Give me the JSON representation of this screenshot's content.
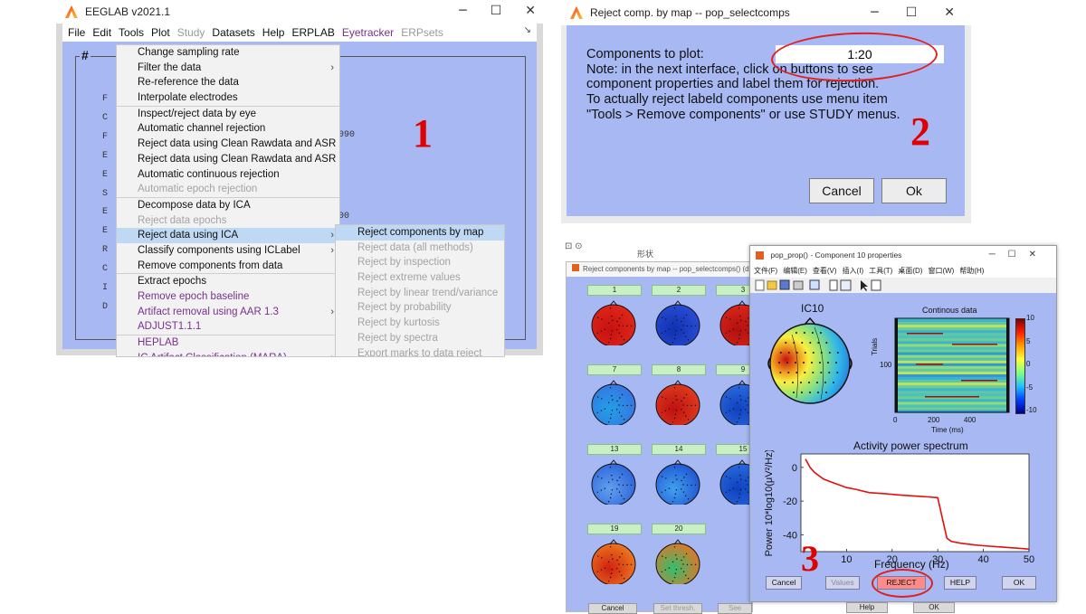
{
  "eeglab": {
    "title": "EEGLAB v2021.1",
    "menubar": [
      {
        "label": "File",
        "state": "normal"
      },
      {
        "label": "Edit",
        "state": "normal"
      },
      {
        "label": "Tools",
        "state": "normal"
      },
      {
        "label": "Plot",
        "state": "normal"
      },
      {
        "label": "Study",
        "state": "disabled"
      },
      {
        "label": "Datasets",
        "state": "normal"
      },
      {
        "label": "Help",
        "state": "normal"
      },
      {
        "label": "ERPLAB",
        "state": "normal"
      },
      {
        "label": "Eyetracker",
        "state": "purple"
      },
      {
        "label": "ERPsets",
        "state": "disabled"
      }
    ],
    "pane_header": "#",
    "side_letters": [
      "F",
      "C",
      "F",
      "E",
      "E",
      "S",
      "E",
      "E",
      "R",
      "C",
      "I",
      "D"
    ],
    "side_values": [
      "090",
      "00"
    ],
    "tools_menu": [
      {
        "label": "Change sampling rate",
        "state": "normal",
        "sub": false,
        "sep": false
      },
      {
        "label": "Filter the data",
        "state": "normal",
        "sub": true,
        "sep": false
      },
      {
        "label": "Re-reference the data",
        "state": "normal",
        "sub": false,
        "sep": false
      },
      {
        "label": "Interpolate electrodes",
        "state": "normal",
        "sub": false,
        "sep": false
      },
      {
        "label": "Inspect/reject data by eye",
        "state": "normal",
        "sub": false,
        "sep": true
      },
      {
        "label": "Automatic channel rejection",
        "state": "normal",
        "sub": false,
        "sep": false
      },
      {
        "label": "Reject data using Clean Rawdata and ASR",
        "state": "normal",
        "sub": false,
        "sep": false
      },
      {
        "label": "Reject data using Clean Rawdata and ASR",
        "state": "normal",
        "sub": false,
        "sep": false
      },
      {
        "label": "Automatic continuous rejection",
        "state": "normal",
        "sub": false,
        "sep": false
      },
      {
        "label": "Automatic epoch rejection",
        "state": "disabled",
        "sub": false,
        "sep": false
      },
      {
        "label": "Decompose data by ICA",
        "state": "normal",
        "sub": false,
        "sep": true
      },
      {
        "label": "Reject data epochs",
        "state": "disabled",
        "sub": false,
        "sep": false
      },
      {
        "label": "Reject data using ICA",
        "state": "selected",
        "sub": true,
        "sep": false
      },
      {
        "label": "Classify components using ICLabel",
        "state": "normal",
        "sub": true,
        "sep": false
      },
      {
        "label": "Remove components from data",
        "state": "normal",
        "sub": false,
        "sep": false
      },
      {
        "label": "Extract epochs",
        "state": "normal",
        "sub": false,
        "sep": true
      },
      {
        "label": "Remove epoch baseline",
        "state": "purple",
        "sub": false,
        "sep": false
      },
      {
        "label": "Artifact removal using AAR 1.3",
        "state": "purple",
        "sub": true,
        "sep": false
      },
      {
        "label": "ADJUST1.1.1",
        "state": "purple",
        "sub": false,
        "sep": false
      },
      {
        "label": "HEPLAB",
        "state": "purple",
        "sub": false,
        "sep": true
      },
      {
        "label": "IC Artifact Classification (MARA)",
        "state": "purple",
        "sub": true,
        "sep": false
      }
    ],
    "ica_submenu": [
      {
        "label": "Reject components by map",
        "state": "selected"
      },
      {
        "label": "Reject data (all methods)",
        "state": "disabled"
      },
      {
        "label": "Reject by inspection",
        "state": "disabled"
      },
      {
        "label": "Reject extreme values",
        "state": "disabled"
      },
      {
        "label": "Reject by linear trend/variance",
        "state": "disabled"
      },
      {
        "label": "Reject by probability",
        "state": "disabled"
      },
      {
        "label": "Reject by kurtosis",
        "state": "disabled"
      },
      {
        "label": "Reject by spectra",
        "state": "disabled"
      },
      {
        "label": "Export marks to data reject",
        "state": "disabled"
      }
    ]
  },
  "steps": {
    "one": "1",
    "two": "2",
    "three": "3"
  },
  "dialog2": {
    "title": "Reject comp. by map -- pop_selectcomps",
    "label": "Components to plot:",
    "value": "1:20",
    "note_lines": [
      "Note: in the next interface, click on buttons to see",
      "component properties and label them for rejection.",
      "To actually reject labeld components use menu item",
      "\"Tools > Remove components\" or use STUDY menus."
    ],
    "cancel": "Cancel",
    "ok": "Ok"
  },
  "grid_window": {
    "caption": "形状",
    "title": "Reject components by map -- pop_selectcomps() (d",
    "component_numbers": [
      "1",
      "2",
      "3",
      "7",
      "8",
      "9",
      "13",
      "14",
      "15",
      "19",
      "20"
    ],
    "buttons": [
      "Cancel",
      "Set thresh.",
      "See comp.",
      "Help",
      "OK"
    ]
  },
  "prop_window": {
    "title": "pop_prop() - Component 10 properties",
    "menu": [
      "文件(F)",
      "编辑(E)",
      "查看(V)",
      "插入(I)",
      "工具(T)",
      "桌面(D)",
      "窗口(W)",
      "帮助(H)"
    ],
    "ic_label": "IC10",
    "erpimage_title": "Continous data",
    "erp_ylabel": "Trials",
    "erp_xlabel": "Time (ms)",
    "erp_ytick": "100",
    "erp_xticks": [
      "0",
      "200",
      "400"
    ],
    "colorbar_ticks": [
      "10",
      "5",
      "0",
      "-5",
      "-10"
    ],
    "spectrum_title": "Activity power spectrum",
    "spectrum_ylabel": "Power 10*log10(μV²/Hz)",
    "spectrum_xlabel": "Frequency (Hz)",
    "buttons": {
      "cancel": "Cancel",
      "values": "Values",
      "reject": "REJECT",
      "help": "HELP",
      "ok": "OK"
    }
  },
  "chart_data": {
    "type": "line",
    "title": "Activity power spectrum",
    "xlabel": "Frequency (Hz)",
    "ylabel": "Power 10*log10(μV²/Hz)",
    "xlim": [
      0,
      50
    ],
    "ylim": [
      -50,
      8
    ],
    "xticks": [
      10,
      20,
      30,
      40,
      50
    ],
    "yticks": [
      0,
      -20,
      -40
    ],
    "grid": false,
    "series": [
      {
        "color": "#e01010",
        "x": [
          1,
          2,
          3,
          5,
          7,
          9,
          10,
          12,
          15,
          18,
          20,
          22,
          25,
          28,
          30,
          31,
          32,
          33,
          35,
          38,
          40,
          45,
          50
        ],
        "y": [
          5,
          0,
          -3,
          -7,
          -9,
          -11,
          -12,
          -13,
          -15,
          -15.5,
          -16,
          -16.5,
          -17,
          -17.5,
          -18,
          -30,
          -42,
          -44,
          -45,
          -46,
          -46.5,
          -47.5,
          -48.5
        ]
      }
    ]
  }
}
